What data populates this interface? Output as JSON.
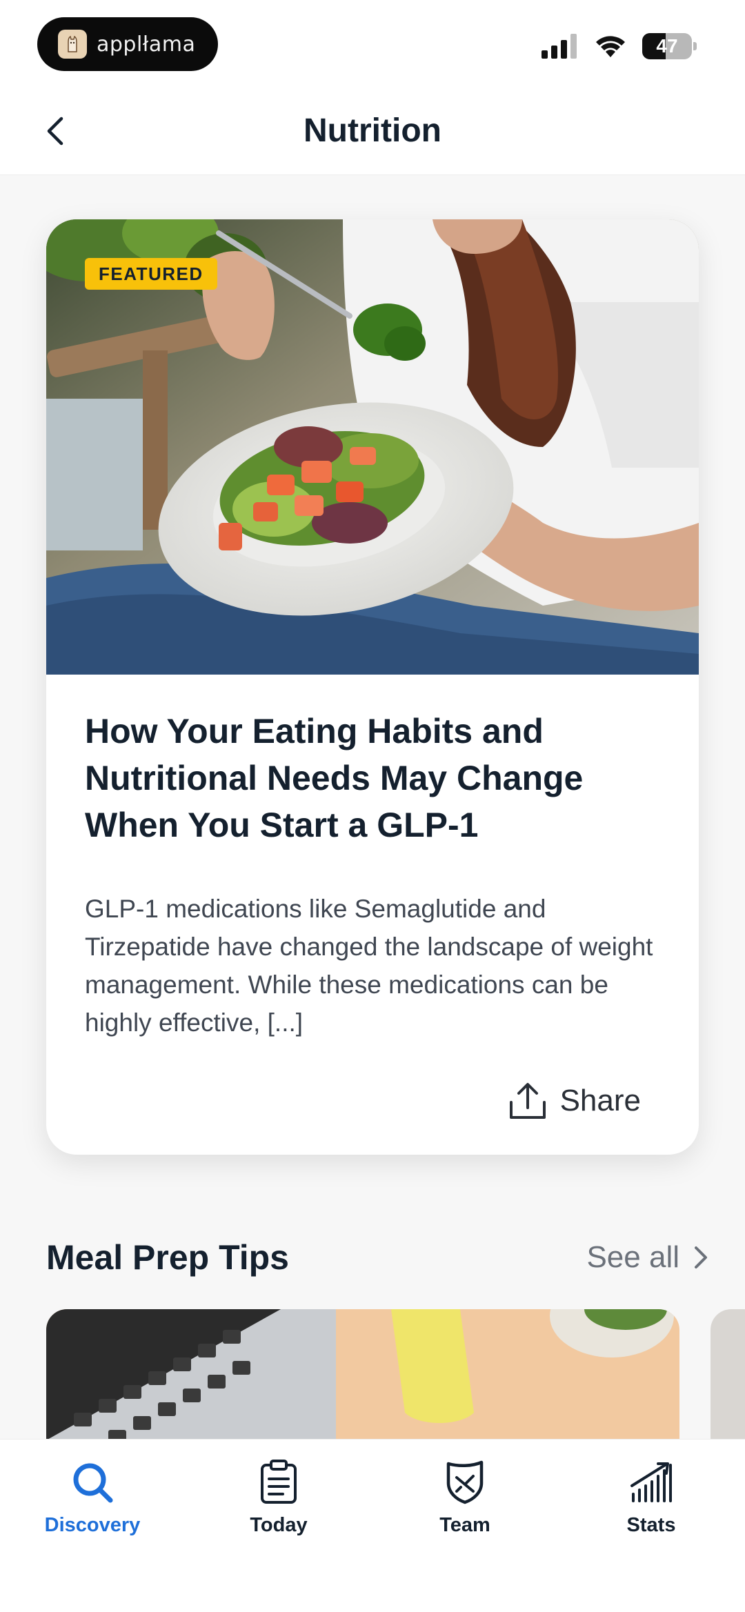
{
  "status_bar": {
    "app_pill_label": "applłama",
    "battery_level": "47",
    "battery_fraction": 0.47
  },
  "header": {
    "title": "Nutrition"
  },
  "featured": {
    "badge": "FEATURED",
    "title": "How Your Eating Habits and Nutritional Needs May Change When You Start a GLP-1",
    "excerpt": "GLP-1 medications like Semaglutide and Tirzepatide have changed the landscape of weight management. While these medications can be highly effective, [...]",
    "share_label": "Share"
  },
  "meal_prep": {
    "title": "Meal Prep Tips",
    "see_all_label": "See all"
  },
  "tab_bar": {
    "tabs": [
      {
        "label": "Discovery",
        "icon": "search-icon",
        "active": true
      },
      {
        "label": "Today",
        "icon": "clipboard-icon",
        "active": false
      },
      {
        "label": "Team",
        "icon": "shield-icon",
        "active": false
      },
      {
        "label": "Stats",
        "icon": "bar-chart-icon",
        "active": false
      }
    ]
  },
  "colors": {
    "accent": "#1e6fd9",
    "badge": "#f8c10a",
    "text_primary": "#14202e",
    "text_secondary": "#3f4651"
  }
}
